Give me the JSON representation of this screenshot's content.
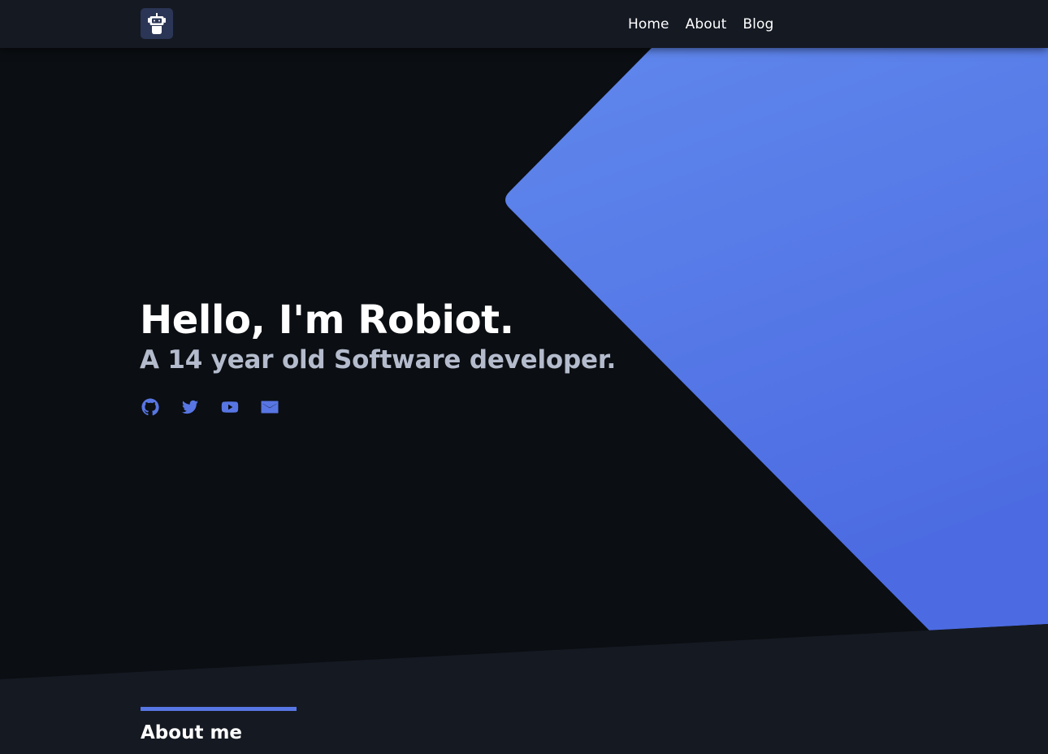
{
  "nav": {
    "logo_icon": "robot-logo-icon",
    "links": [
      {
        "label": "Home"
      },
      {
        "label": "About"
      },
      {
        "label": "Blog"
      }
    ]
  },
  "hero": {
    "title": "Hello, I'm Robiot.",
    "subtitle": "A 14 year old Software developer.",
    "socials": [
      {
        "icon": "github-icon"
      },
      {
        "icon": "twitter-icon"
      },
      {
        "icon": "youtube-icon"
      },
      {
        "icon": "mail-icon"
      }
    ]
  },
  "about": {
    "heading": "About me"
  },
  "colors": {
    "background": "#0b0e12",
    "navbar": "#151922",
    "accent": "#5876e3",
    "subtitle": "#b3bbcc"
  }
}
